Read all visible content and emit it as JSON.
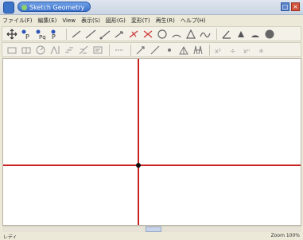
{
  "window": {
    "title": "Sketch Geometry"
  },
  "menu": [
    {
      "label": "ファイル(F)"
    },
    {
      "label": "編集(E)"
    },
    {
      "label": "View"
    },
    {
      "label": "表示(S)"
    },
    {
      "label": "図形(G)"
    },
    {
      "label": "変形(T)"
    },
    {
      "label": "再生(R)"
    },
    {
      "label": "ヘルプ(H)"
    }
  ],
  "toolbar1": [
    {
      "icon": "move-icon"
    },
    {
      "icon": "point-icon"
    },
    {
      "icon": "point-on-object-icon"
    },
    {
      "icon": "point-label-icon"
    },
    {
      "icon": "segment-icon"
    },
    {
      "icon": "line-icon"
    },
    {
      "icon": "ray-icon"
    },
    {
      "icon": "vector-icon"
    },
    {
      "icon": "perpendicular-icon"
    },
    {
      "icon": "midpoint-icon"
    },
    {
      "icon": "circle-icon"
    },
    {
      "icon": "arc-icon"
    },
    {
      "icon": "polygon-icon"
    },
    {
      "icon": "locus-icon"
    },
    {
      "icon": "angle-icon"
    },
    {
      "icon": "color-fill-icon"
    },
    {
      "icon": "color-icon"
    },
    {
      "icon": "grey-circle-icon"
    }
  ],
  "toolbar2": [
    {
      "icon": "regular-polygon-icon"
    },
    {
      "icon": "symmetric-icon"
    },
    {
      "icon": "rotate-icon"
    },
    {
      "icon": "reflect-icon"
    },
    {
      "icon": "translate-icon"
    },
    {
      "icon": "dilate-icon"
    },
    {
      "icon": "measure-icon"
    },
    {
      "icon": "text-icon"
    },
    {
      "icon": "trace-icon"
    },
    {
      "icon": "slope-icon"
    },
    {
      "icon": "point-tool-icon"
    },
    {
      "icon": "triangle-icon"
    },
    {
      "icon": "tower-icon"
    },
    {
      "icon": "function-icon"
    },
    {
      "icon": "calc-icon"
    },
    {
      "icon": "power-icon"
    },
    {
      "icon": "star-icon"
    }
  ],
  "status": {
    "left": "レディ",
    "right": "Zoom 100%"
  },
  "colors": {
    "axis": "#c72222",
    "canvas": "#ffffff"
  }
}
